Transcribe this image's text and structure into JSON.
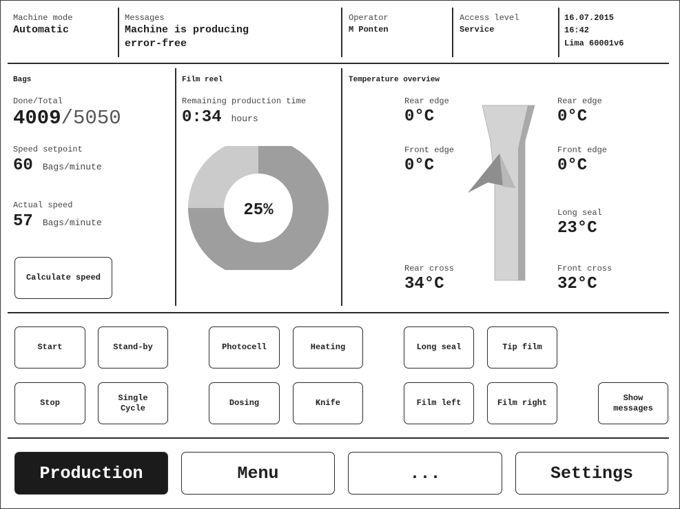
{
  "header": {
    "machine_mode_label": "Machine mode",
    "machine_mode_value": "Automatic",
    "messages_label": "Messages",
    "messages_value_line1": "Machine is producing",
    "messages_value_line2": "error-free",
    "operator_label": "Operator",
    "operator_value": "M Ponten",
    "access_level_label": "Access level",
    "access_level_value": "Service",
    "date": "16.07.2015",
    "time": "16:42",
    "machine_id": "Lima 60001v6"
  },
  "bags": {
    "title": "Bags",
    "done_total_label": "Done/Total",
    "done": "4009",
    "separator": "/",
    "total": "5050",
    "speed_setpoint_label": "Speed setpoint",
    "speed_setpoint_value": "60",
    "speed_setpoint_unit": "Bags/minute",
    "actual_speed_label": "Actual speed",
    "actual_speed_value": "57",
    "actual_speed_unit": "Bags/minute",
    "calculate_button": "Calculate speed"
  },
  "film_reel": {
    "title": "Film reel",
    "remaining_label": "Remaining production time",
    "remaining_value": "0:34",
    "remaining_unit": "hours",
    "percent_label": "25%",
    "percent_value": 25,
    "colors": {
      "remaining": "#cbcbcb",
      "used": "#9e9e9e"
    }
  },
  "temperature": {
    "title": "Temperature overview",
    "rear_edge_left_label": "Rear edge",
    "rear_edge_left_value": "0°C",
    "front_edge_left_label": "Front edge",
    "front_edge_left_value": "0°C",
    "rear_cross_label": "Rear cross",
    "rear_cross_value": "34°C",
    "rear_edge_right_label": "Rear edge",
    "rear_edge_right_value": "0°C",
    "front_edge_right_label": "Front edge",
    "front_edge_right_value": "0°C",
    "long_seal_label": "Long seal",
    "long_seal_value": "23°C",
    "front_cross_label": "Front cross",
    "front_cross_value": "32°C"
  },
  "controls": {
    "start": "Start",
    "stand_by": "Stand-by",
    "photocell": "Photocell",
    "heating": "Heating",
    "long_seal": "Long seal",
    "tip_film": "Tip film",
    "stop": "Stop",
    "single_cycle": "Single\nCycle",
    "dosing": "Dosing",
    "knife": "Knife",
    "film_left": "Film left",
    "film_right": "Film right",
    "show_messages": "Show\nmessages"
  },
  "nav": {
    "production": "Production",
    "menu": "Menu",
    "more": "...",
    "settings": "Settings"
  }
}
